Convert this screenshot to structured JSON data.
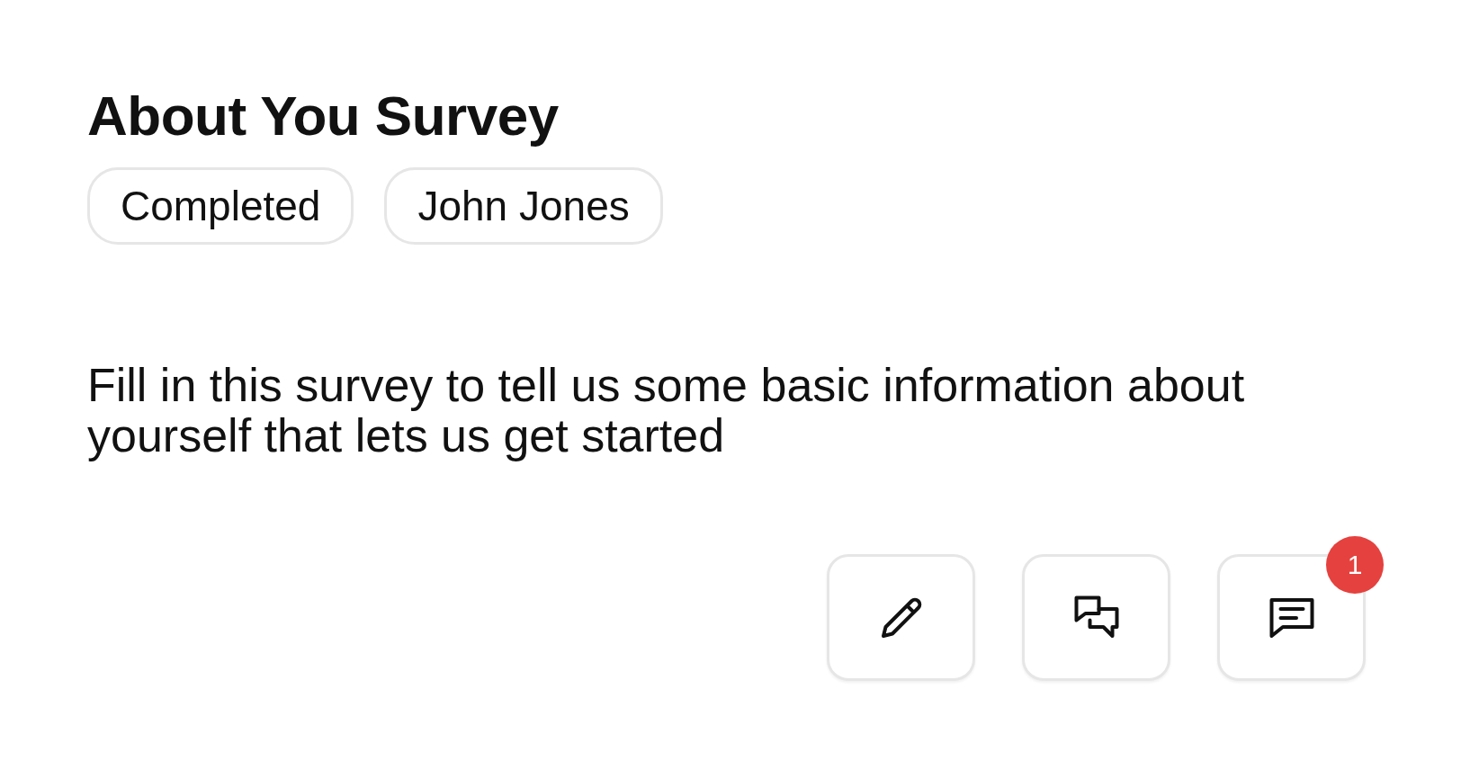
{
  "title": "About You Survey",
  "tags": [
    "Completed",
    "John Jones"
  ],
  "description": "Fill in this survey to tell us some basic information about yourself that lets us get started",
  "actions": [
    {
      "kind": "edit"
    },
    {
      "kind": "conversation"
    },
    {
      "kind": "comment",
      "badge": "1"
    }
  ]
}
